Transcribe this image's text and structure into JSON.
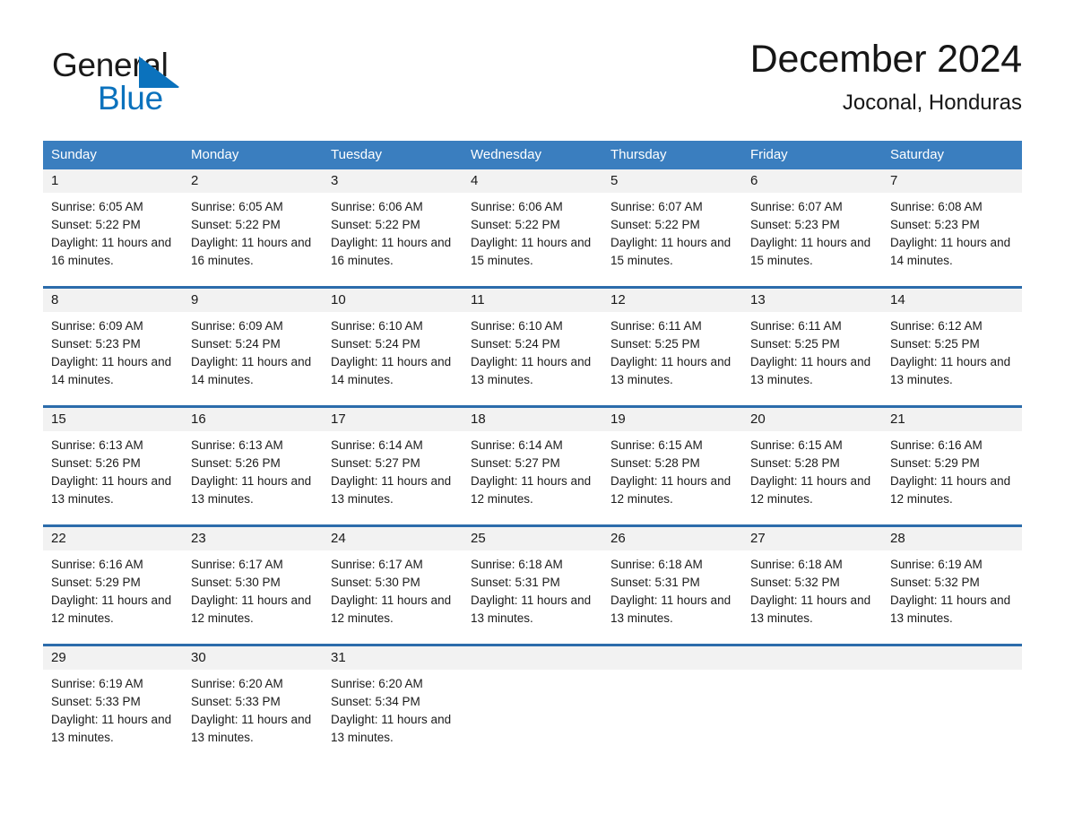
{
  "brand": {
    "name_part1": "General",
    "name_part2": "Blue",
    "logo_icon": "blue-triangle-icon",
    "accent_color": "#0b72bd"
  },
  "header": {
    "title": "December 2024",
    "subtitle": "Joconal, Honduras"
  },
  "theme": {
    "header_blue": "#3a7ebf",
    "row_rule_blue": "#2c6cab",
    "date_band_gray": "#f2f2f2",
    "text_dark": "#1a1a1a"
  },
  "weekdays": [
    "Sunday",
    "Monday",
    "Tuesday",
    "Wednesday",
    "Thursday",
    "Friday",
    "Saturday"
  ],
  "weeks": [
    {
      "days": [
        {
          "date": "1",
          "sunrise": "Sunrise: 6:05 AM",
          "sunset": "Sunset: 5:22 PM",
          "daylight": "Daylight: 11 hours and 16 minutes."
        },
        {
          "date": "2",
          "sunrise": "Sunrise: 6:05 AM",
          "sunset": "Sunset: 5:22 PM",
          "daylight": "Daylight: 11 hours and 16 minutes."
        },
        {
          "date": "3",
          "sunrise": "Sunrise: 6:06 AM",
          "sunset": "Sunset: 5:22 PM",
          "daylight": "Daylight: 11 hours and 16 minutes."
        },
        {
          "date": "4",
          "sunrise": "Sunrise: 6:06 AM",
          "sunset": "Sunset: 5:22 PM",
          "daylight": "Daylight: 11 hours and 15 minutes."
        },
        {
          "date": "5",
          "sunrise": "Sunrise: 6:07 AM",
          "sunset": "Sunset: 5:22 PM",
          "daylight": "Daylight: 11 hours and 15 minutes."
        },
        {
          "date": "6",
          "sunrise": "Sunrise: 6:07 AM",
          "sunset": "Sunset: 5:23 PM",
          "daylight": "Daylight: 11 hours and 15 minutes."
        },
        {
          "date": "7",
          "sunrise": "Sunrise: 6:08 AM",
          "sunset": "Sunset: 5:23 PM",
          "daylight": "Daylight: 11 hours and 14 minutes."
        }
      ]
    },
    {
      "days": [
        {
          "date": "8",
          "sunrise": "Sunrise: 6:09 AM",
          "sunset": "Sunset: 5:23 PM",
          "daylight": "Daylight: 11 hours and 14 minutes."
        },
        {
          "date": "9",
          "sunrise": "Sunrise: 6:09 AM",
          "sunset": "Sunset: 5:24 PM",
          "daylight": "Daylight: 11 hours and 14 minutes."
        },
        {
          "date": "10",
          "sunrise": "Sunrise: 6:10 AM",
          "sunset": "Sunset: 5:24 PM",
          "daylight": "Daylight: 11 hours and 14 minutes."
        },
        {
          "date": "11",
          "sunrise": "Sunrise: 6:10 AM",
          "sunset": "Sunset: 5:24 PM",
          "daylight": "Daylight: 11 hours and 13 minutes."
        },
        {
          "date": "12",
          "sunrise": "Sunrise: 6:11 AM",
          "sunset": "Sunset: 5:25 PM",
          "daylight": "Daylight: 11 hours and 13 minutes."
        },
        {
          "date": "13",
          "sunrise": "Sunrise: 6:11 AM",
          "sunset": "Sunset: 5:25 PM",
          "daylight": "Daylight: 11 hours and 13 minutes."
        },
        {
          "date": "14",
          "sunrise": "Sunrise: 6:12 AM",
          "sunset": "Sunset: 5:25 PM",
          "daylight": "Daylight: 11 hours and 13 minutes."
        }
      ]
    },
    {
      "days": [
        {
          "date": "15",
          "sunrise": "Sunrise: 6:13 AM",
          "sunset": "Sunset: 5:26 PM",
          "daylight": "Daylight: 11 hours and 13 minutes."
        },
        {
          "date": "16",
          "sunrise": "Sunrise: 6:13 AM",
          "sunset": "Sunset: 5:26 PM",
          "daylight": "Daylight: 11 hours and 13 minutes."
        },
        {
          "date": "17",
          "sunrise": "Sunrise: 6:14 AM",
          "sunset": "Sunset: 5:27 PM",
          "daylight": "Daylight: 11 hours and 13 minutes."
        },
        {
          "date": "18",
          "sunrise": "Sunrise: 6:14 AM",
          "sunset": "Sunset: 5:27 PM",
          "daylight": "Daylight: 11 hours and 12 minutes."
        },
        {
          "date": "19",
          "sunrise": "Sunrise: 6:15 AM",
          "sunset": "Sunset: 5:28 PM",
          "daylight": "Daylight: 11 hours and 12 minutes."
        },
        {
          "date": "20",
          "sunrise": "Sunrise: 6:15 AM",
          "sunset": "Sunset: 5:28 PM",
          "daylight": "Daylight: 11 hours and 12 minutes."
        },
        {
          "date": "21",
          "sunrise": "Sunrise: 6:16 AM",
          "sunset": "Sunset: 5:29 PM",
          "daylight": "Daylight: 11 hours and 12 minutes."
        }
      ]
    },
    {
      "days": [
        {
          "date": "22",
          "sunrise": "Sunrise: 6:16 AM",
          "sunset": "Sunset: 5:29 PM",
          "daylight": "Daylight: 11 hours and 12 minutes."
        },
        {
          "date": "23",
          "sunrise": "Sunrise: 6:17 AM",
          "sunset": "Sunset: 5:30 PM",
          "daylight": "Daylight: 11 hours and 12 minutes."
        },
        {
          "date": "24",
          "sunrise": "Sunrise: 6:17 AM",
          "sunset": "Sunset: 5:30 PM",
          "daylight": "Daylight: 11 hours and 12 minutes."
        },
        {
          "date": "25",
          "sunrise": "Sunrise: 6:18 AM",
          "sunset": "Sunset: 5:31 PM",
          "daylight": "Daylight: 11 hours and 13 minutes."
        },
        {
          "date": "26",
          "sunrise": "Sunrise: 6:18 AM",
          "sunset": "Sunset: 5:31 PM",
          "daylight": "Daylight: 11 hours and 13 minutes."
        },
        {
          "date": "27",
          "sunrise": "Sunrise: 6:18 AM",
          "sunset": "Sunset: 5:32 PM",
          "daylight": "Daylight: 11 hours and 13 minutes."
        },
        {
          "date": "28",
          "sunrise": "Sunrise: 6:19 AM",
          "sunset": "Sunset: 5:32 PM",
          "daylight": "Daylight: 11 hours and 13 minutes."
        }
      ]
    },
    {
      "days": [
        {
          "date": "29",
          "sunrise": "Sunrise: 6:19 AM",
          "sunset": "Sunset: 5:33 PM",
          "daylight": "Daylight: 11 hours and 13 minutes."
        },
        {
          "date": "30",
          "sunrise": "Sunrise: 6:20 AM",
          "sunset": "Sunset: 5:33 PM",
          "daylight": "Daylight: 11 hours and 13 minutes."
        },
        {
          "date": "31",
          "sunrise": "Sunrise: 6:20 AM",
          "sunset": "Sunset: 5:34 PM",
          "daylight": "Daylight: 11 hours and 13 minutes."
        },
        {
          "date": "",
          "sunrise": "",
          "sunset": "",
          "daylight": ""
        },
        {
          "date": "",
          "sunrise": "",
          "sunset": "",
          "daylight": ""
        },
        {
          "date": "",
          "sunrise": "",
          "sunset": "",
          "daylight": ""
        },
        {
          "date": "",
          "sunrise": "",
          "sunset": "",
          "daylight": ""
        }
      ]
    }
  ]
}
